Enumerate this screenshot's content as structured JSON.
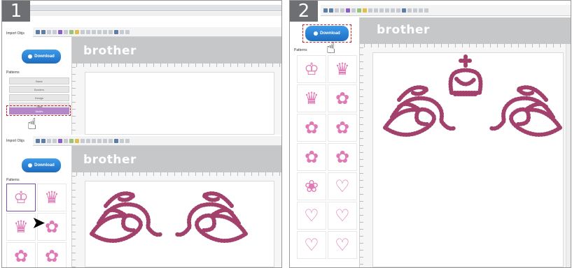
{
  "steps": [
    "1",
    "2"
  ],
  "app": {
    "brand": "brother",
    "download_label": "Download",
    "import_label": "Import Objs",
    "patterns_label": "Patterns"
  },
  "sidebar_categories": [
    "Basic",
    "Borders",
    "Design",
    "Tags",
    "Motifs"
  ],
  "thumbnails": {
    "step1": [
      "crown-icon",
      "tiara-icon",
      "tiara-icon",
      "flower-icon",
      "flower-icon",
      "flower-icon"
    ],
    "step2": [
      "crown-icon",
      "tiara-icon",
      "tiara-icon",
      "flower-icon",
      "flower-icon",
      "flower-icon",
      "flower-icon",
      "flower-icon",
      "rose-icon",
      "heart-icon",
      "heart-icon",
      "heart-icon",
      "heart-icon",
      "heart-icon"
    ]
  },
  "glyphs": {
    "crown": "♔",
    "tiara": "♛",
    "flower": "✿",
    "rose": "❀",
    "heart": "♡",
    "pointer": "☝"
  },
  "colors": {
    "badge": "#6d6f72",
    "highlight": "#d01a2b",
    "motif": "#a2416b",
    "thumb": "#e079b5",
    "button": "#1d6cc0"
  }
}
